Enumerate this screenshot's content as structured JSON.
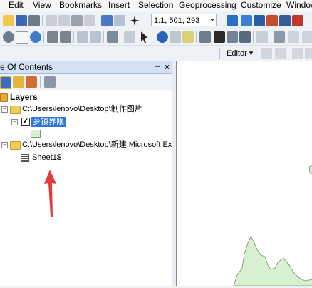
{
  "menubar": {
    "items": [
      {
        "prefix": "",
        "underline": "E",
        "rest": "dit"
      },
      {
        "prefix": "",
        "underline": "V",
        "rest": "iew"
      },
      {
        "prefix": "",
        "underline": "B",
        "rest": "ookmarks"
      },
      {
        "prefix": "",
        "underline": "I",
        "rest": "nsert"
      },
      {
        "prefix": "",
        "underline": "S",
        "rest": "election"
      },
      {
        "prefix": "",
        "underline": "G",
        "rest": "eoprocessing"
      },
      {
        "prefix": "",
        "underline": "C",
        "rest": "ustomize"
      },
      {
        "prefix": "",
        "underline": "W",
        "rest": "indow"
      }
    ]
  },
  "toolbar": {
    "scale_value": "1:1, 501, 293",
    "editor_label": "Editor"
  },
  "toc": {
    "title": "e Of Contents",
    "pin_glyph": "⊣",
    "close_glyph": "×",
    "layers_label": "Layers",
    "folder1": "C:\\Users\\lenovo\\Desktop\\制作图片",
    "layer_name": "乡镇界限",
    "folder2": "C:\\Users\\lenovo\\Desktop\\新建 Microsoft Ex",
    "table_name": "Sheet1$"
  },
  "colors": {
    "selection": "#3179d6",
    "map_polygon": "#d7f0d2",
    "arrow": "#e23b3b"
  }
}
